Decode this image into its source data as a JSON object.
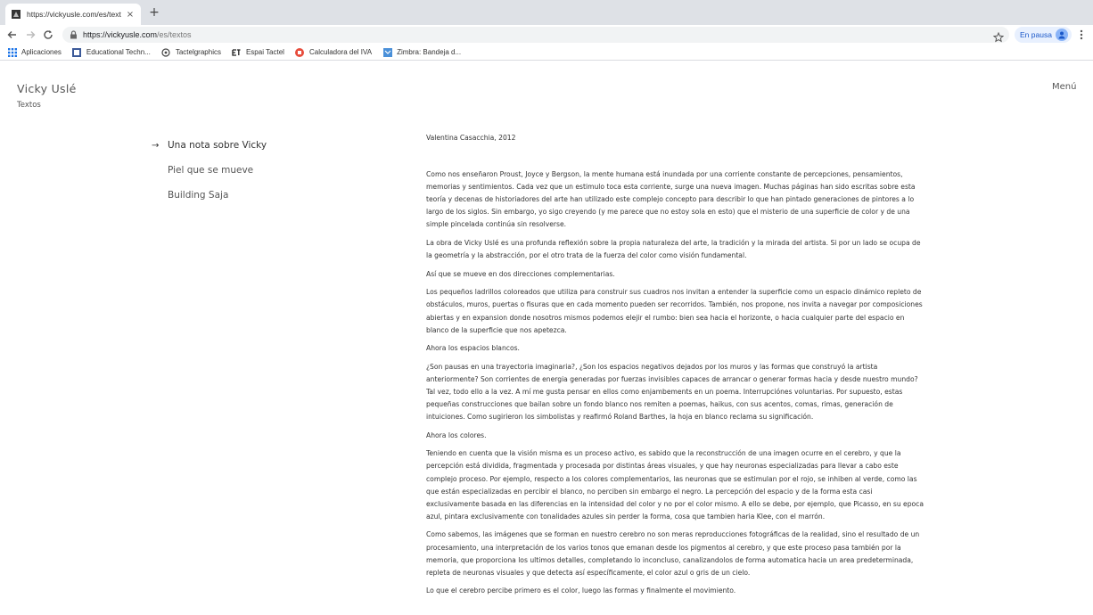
{
  "browser": {
    "tab_title": "https://vickyusle.com/es/texto",
    "tab_close": "×",
    "new_tab": "+",
    "url_host": "https://vickyusle.com",
    "url_path": "/es/textos",
    "profile_label": "En pausa",
    "bookmarks": [
      {
        "label": "Aplicaciones",
        "icon": "apps-grid-icon"
      },
      {
        "label": "Educational Techn...",
        "icon": "bookmark-favicon"
      },
      {
        "label": "Tactelgraphics",
        "icon": "bookmark-favicon"
      },
      {
        "label": "Espai Tactel",
        "icon": "bookmark-favicon"
      },
      {
        "label": "Calculadora del IVA",
        "icon": "bookmark-favicon"
      },
      {
        "label": "Zimbra: Bandeja d...",
        "icon": "bookmark-favicon"
      }
    ]
  },
  "site": {
    "title": "Vicky Uslé",
    "subtitle": "Textos",
    "menu": "Menú"
  },
  "side_nav": [
    {
      "label": "Una nota sobre Vicky",
      "active": true,
      "arrow": "→"
    },
    {
      "label": "Piel que se mueve",
      "active": false,
      "arrow": ""
    },
    {
      "label": "Building Saja",
      "active": false,
      "arrow": ""
    }
  ],
  "article": {
    "author": "Valentina Casacchia, 2012",
    "paragraphs": [
      "Como nos enseñaron Proust, Joyce y Bergson, la mente humana está inundada por una corriente constante de percepciones, pensamientos, memorias y sentimientos. Cada vez que un estimulo toca esta corriente, surge una nueva imagen. Muchas páginas han sido escritas sobre esta teoría y decenas de historiadores del arte han utilizado este complejo concepto para describir lo que han pintado generaciones de pintores a lo largo de los siglos. Sin embargo, yo sigo creyendo (y me parece que no estoy sola en esto) que el misterio de una superficie de color y de una simple pincelada continúa sin resolverse.",
      "La obra de Vicky Uslé es una profunda reflexión sobre la propia naturaleza del arte, la tradición y la mirada del artista. Si por un lado se ocupa de la geometría y la abstracción, por el otro trata de la fuerza del color como visión fundamental.",
      "Así que se mueve en dos direcciones complementarias.",
      "Los pequeños ladrillos coloreados que utiliza para construir sus cuadros nos invitan a entender la superficie como un espacio dinámico repleto de obstáculos, muros, puertas o fisuras que en cada momento pueden ser recorridos. También, nos propone, nos invita a navegar por composiciones abiertas y en expansion donde nosotros mismos podemos elejir el rumbo: bien sea hacia el horizonte, o hacia cualquier parte del espacio en blanco de la superficie que nos apetezca.",
      "Ahora los espacios blancos.",
      "¿Son pausas en una trayectoria imaginaria?, ¿Son los espacios negativos dejados por los muros y las formas que construyó la artista anteriormente? Son corrientes de energia generadas por fuerzas invisibles capaces de arrancar o generar formas hacia y desde nuestro mundo? Tal vez, todo ello a la vez. A mí me gusta pensar en ellos como enjambements en un poema. Interrupciónes voluntarias. Por supuesto, estas pequeñas construcciones que bailan sobre un fondo blanco nos remiten a poemas, haikus, con sus acentos, comas, rimas, generación de intuiciones. Como sugirieron los simbolistas y reafirmó Roland Barthes, la hoja en blanco reclama su significación.",
      "Ahora los colores.",
      "Teniendo en cuenta que la visión misma es un proceso activo, es sabido que la reconstrucción de una imagen ocurre en el cerebro, y que la percepción está dividida, fragmentada y procesada por distintas áreas visuales, y que hay neuronas especializadas para llevar a cabo este complejo proceso. Por ejemplo, respecto a los colores complementarios, las neuronas que se estimulan por el rojo, se inhiben al verde, como las que están especializadas en percibir el blanco, no perciben sin embargo el negro. La percepción del espacio y de la forma esta casi exclusivamente basada en las diferencias en la intensidad del color y no por el color mismo. A ello se debe, por ejemplo, que Picasso, en su epoca azul, pintara exclusivamente con tonalidades azules sin perder la forma, cosa que tambien haria Klee, con el marrón.",
      "Como sabemos, las imágenes que se forman en nuestro cerebro no son meras reproducciones fotográficas de la realidad, sino el resultado de un procesamiento, una interpretación de los varios tonos que emanan desde los pigmentos al cerebro, y que este proceso pasa también por la memoria, que proporciona los ultimos detalles, completando lo inconcluso, canalizandolos de forma automatica hacia un area predeterminada, repleta de neuronas visuales y que detecta así específicamente, el color azul o gris de un cielo.",
      "Lo que el cerebro percibe primero es el color, luego las formas y finalmente el movimiento."
    ]
  },
  "colors": {
    "tabstrip": "#dee1e6",
    "omnibox": "#f1f3f4",
    "profile_bg": "#e8f0fe",
    "profile_text": "#1a57c9",
    "text": "#333333"
  }
}
